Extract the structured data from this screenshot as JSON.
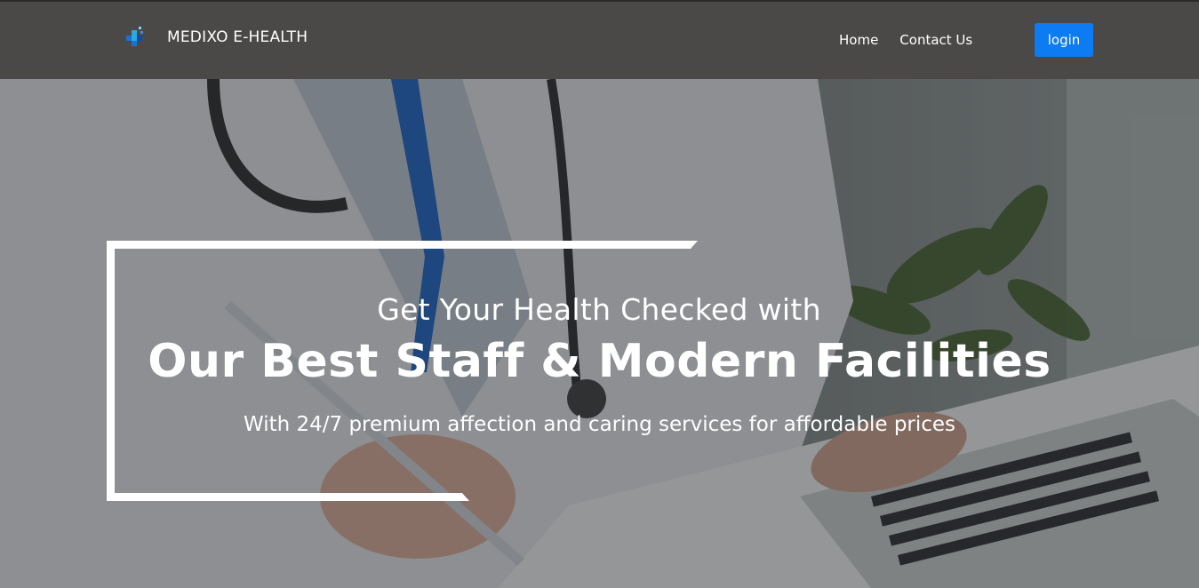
{
  "header": {
    "brand_name": "MEDIXO E-HEALTH",
    "logo_icon": "medical-cross-icon",
    "nav": [
      {
        "label": "Home"
      },
      {
        "label": "Contact Us"
      }
    ],
    "login_label": "login"
  },
  "hero": {
    "subtitle": "Get Your Health Checked with",
    "title": "Our Best Staff & Modern Facilities",
    "tagline": "With 24/7 premium affection and caring services for affordable prices"
  },
  "colors": {
    "navbar": "#4a4948",
    "login_button": "#0d7cf2",
    "text": "#ffffff"
  }
}
